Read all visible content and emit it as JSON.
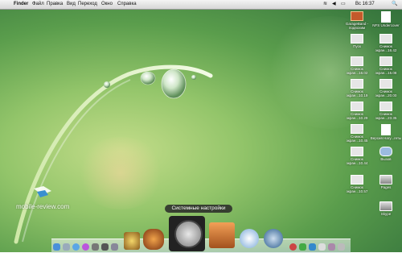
{
  "menubar": {
    "apple_glyph": "",
    "app_name": "Finder",
    "menus": [
      "Файл",
      "Правка",
      "Вид",
      "Переход",
      "Окно",
      "Справка"
    ],
    "clock": "Вс 16:37",
    "spotlight_glyph": "🔍"
  },
  "desktop_icons": [
    {
      "label": "GarageBand - подвохим"
    },
    {
      "label": "NFS Undercover"
    },
    {
      "label": "Пуск"
    },
    {
      "label": "Снимок экран...16.42"
    },
    {
      "label": "Снимок экран...16.02"
    },
    {
      "label": "Снимок экран...15.08"
    },
    {
      "label": "Снимок экран...10.19"
    },
    {
      "label": "Снимок экран...20.00"
    },
    {
      "label": "Снимок экран...10.29"
    },
    {
      "label": "Снимок экран...23.35"
    },
    {
      "label": "Снимок экран...10.45"
    },
    {
      "label": "Версия Hary...геты"
    },
    {
      "label": "Снимок экран...10.44"
    },
    {
      "label": "Вызов"
    },
    {
      "label": "Снимок экран...10.57"
    },
    {
      "label": "Pages"
    },
    {
      "label": "Skype"
    }
  ],
  "watermark": "mobile-review.com",
  "dock": {
    "tooltip": "Системные настройки",
    "items": [
      "finder",
      "mail",
      "safari",
      "itunes",
      "imovie",
      "garageband",
      "system-preferences",
      "keynote",
      "itunes-circle",
      "preview",
      "sketch",
      "trash"
    ]
  }
}
